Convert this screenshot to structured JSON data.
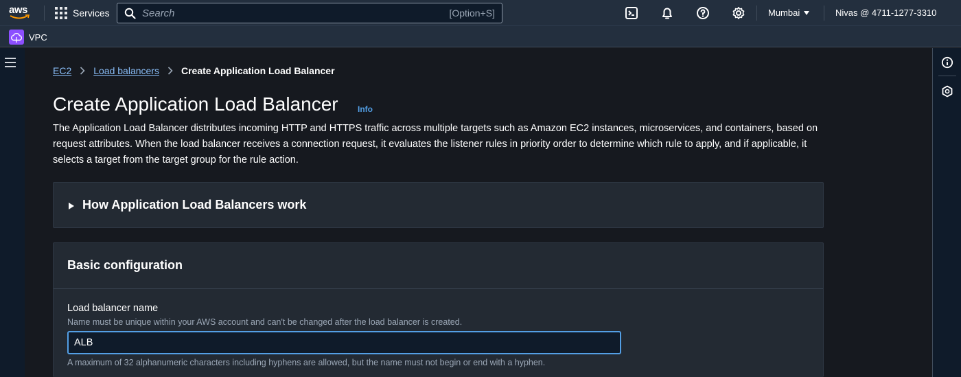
{
  "topnav": {
    "logo_text": "aws",
    "services_label": "Services",
    "search": {
      "placeholder": "Search",
      "shortcut": "[Option+S]"
    },
    "icons": [
      "cloudshell-icon",
      "bell-icon",
      "help-icon",
      "settings-icon"
    ],
    "region": "Mumbai",
    "account": "Nivas @ 4711-1277-3310"
  },
  "servicebar": {
    "service_label": "VPC"
  },
  "breadcrumb": {
    "items": [
      {
        "label": "EC2"
      },
      {
        "label": "Load balancers"
      },
      {
        "label": "Create Application Load Balancer"
      }
    ]
  },
  "page": {
    "title": "Create Application Load Balancer",
    "info_label": "Info",
    "description": "The Application Load Balancer distributes incoming HTTP and HTTPS traffic across multiple targets such as Amazon EC2 instances, microservices, and containers, based on request attributes. When the load balancer receives a connection request, it evaluates the listener rules in priority order to determine which rule to apply, and if applicable, it selects a target from the target group for the rule action."
  },
  "how_panel": {
    "title": "How Application Load Balancers work",
    "expanded": false
  },
  "basic_config": {
    "title": "Basic configuration",
    "name_field": {
      "label": "Load balancer name",
      "description": "Name must be unique within your AWS account and can't be changed after the load balancer is created.",
      "value": "ALB",
      "constraint": "A maximum of 32 alphanumeric characters including hyphens are allowed, but the name must not begin or end with a hyphen."
    }
  },
  "colors": {
    "topnav_bg": "#232f3e",
    "page_bg": "#16191f",
    "link": "#89bdf7",
    "focus": "#539fe5",
    "service_badge": "#8c4fff",
    "aws_smile": "#ff9900"
  }
}
